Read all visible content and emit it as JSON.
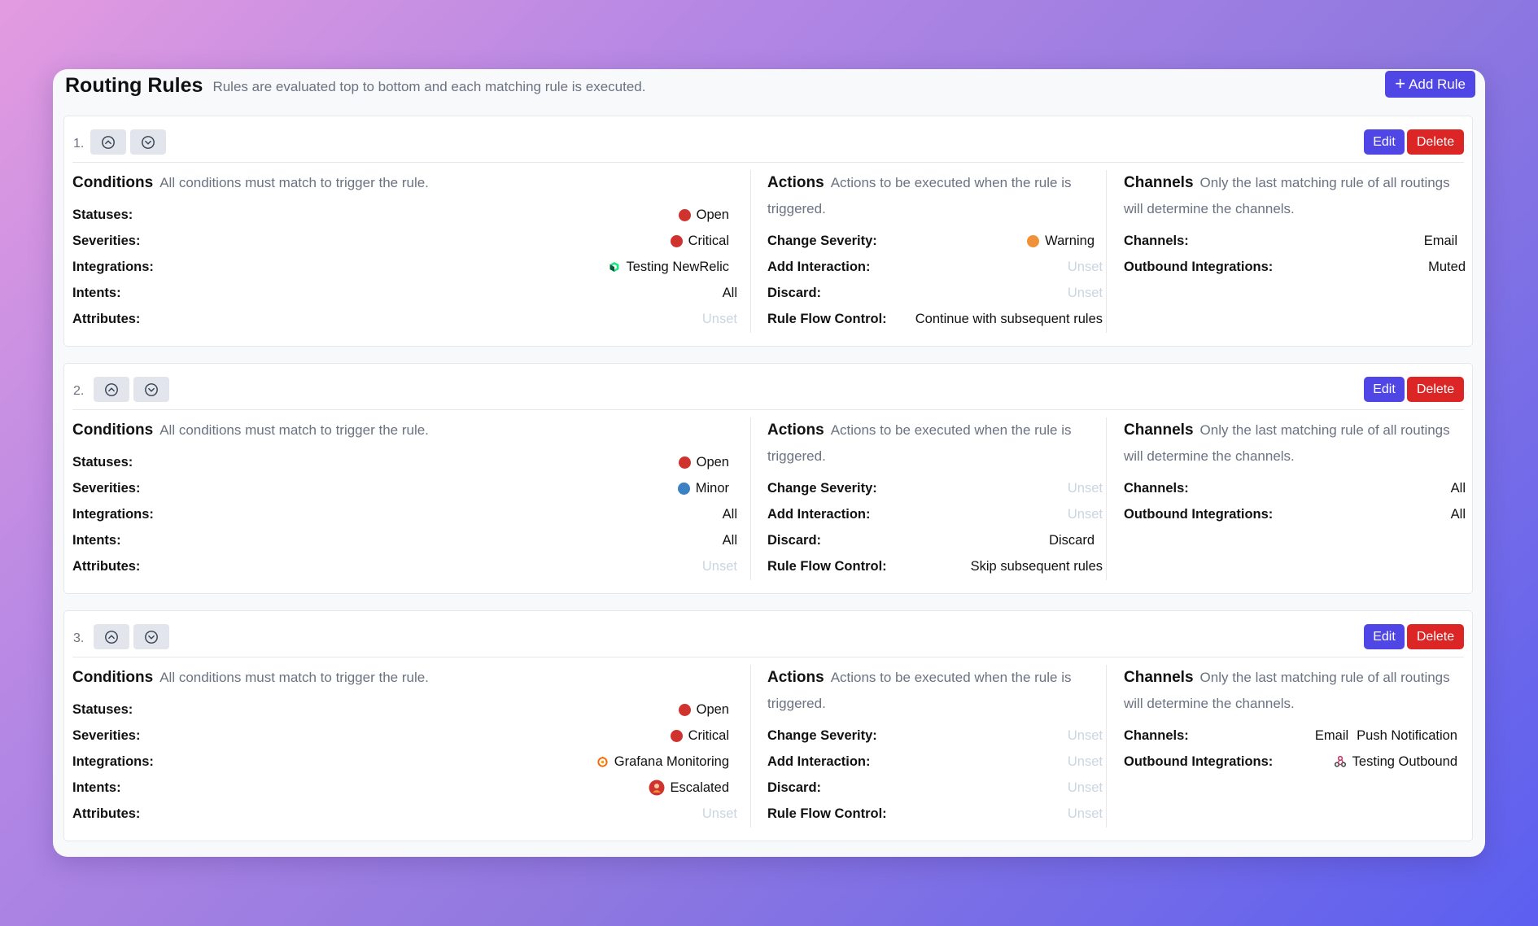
{
  "header": {
    "title": "Routing Rules",
    "subtitle": "Rules are evaluated top to bottom and each matching rule is executed.",
    "add_rule_label": "Add Rule"
  },
  "labels": {
    "edit": "Edit",
    "delete": "Delete",
    "conditions_title": "Conditions",
    "conditions_desc": "All conditions must match to trigger the rule.",
    "actions_title": "Actions",
    "actions_desc": "Actions to be executed when the rule is triggered.",
    "channels_title": "Channels",
    "channels_desc": "Only the last matching rule of all routings will determine the channels.",
    "statuses": "Statuses:",
    "severities": "Severities:",
    "integrations": "Integrations:",
    "intents": "Intents:",
    "attributes": "Attributes:",
    "change_severity": "Change Severity:",
    "add_interaction": "Add Interaction:",
    "discard": "Discard:",
    "rule_flow_control": "Rule Flow Control:",
    "channels": "Channels:",
    "outbound_integrations": "Outbound Integrations:"
  },
  "colors": {
    "red": "#d0332e",
    "orange": "#f0913a",
    "blue": "#3b82c4",
    "primary": "#4f46e5",
    "danger": "#dc2626"
  },
  "rules": [
    {
      "number": "1.",
      "statuses": "Open",
      "severities": "Critical",
      "integrations": "Testing NewRelic",
      "intents": "All",
      "attributes": "Unset",
      "change_severity": "Warning",
      "add_interaction": "Unset",
      "discard": "Unset",
      "rule_flow_control": "Continue with subsequent rules",
      "channels": [
        "Email"
      ],
      "outbound_integrations": "Muted"
    },
    {
      "number": "2.",
      "statuses": "Open",
      "severities": "Minor",
      "integrations": "All",
      "intents": "All",
      "attributes": "Unset",
      "change_severity": "Unset",
      "add_interaction": "Unset",
      "discard": "Discard",
      "rule_flow_control": "Skip subsequent rules",
      "channels": [
        "All"
      ],
      "outbound_integrations": "All"
    },
    {
      "number": "3.",
      "statuses": "Open",
      "severities": "Critical",
      "integrations": "Grafana Monitoring",
      "intents": "Escalated",
      "attributes": "Unset",
      "change_severity": "Unset",
      "add_interaction": "Unset",
      "discard": "Unset",
      "rule_flow_control": "Unset",
      "channels": [
        "Email",
        "Push Notification"
      ],
      "outbound_integrations": "Testing Outbound"
    }
  ]
}
